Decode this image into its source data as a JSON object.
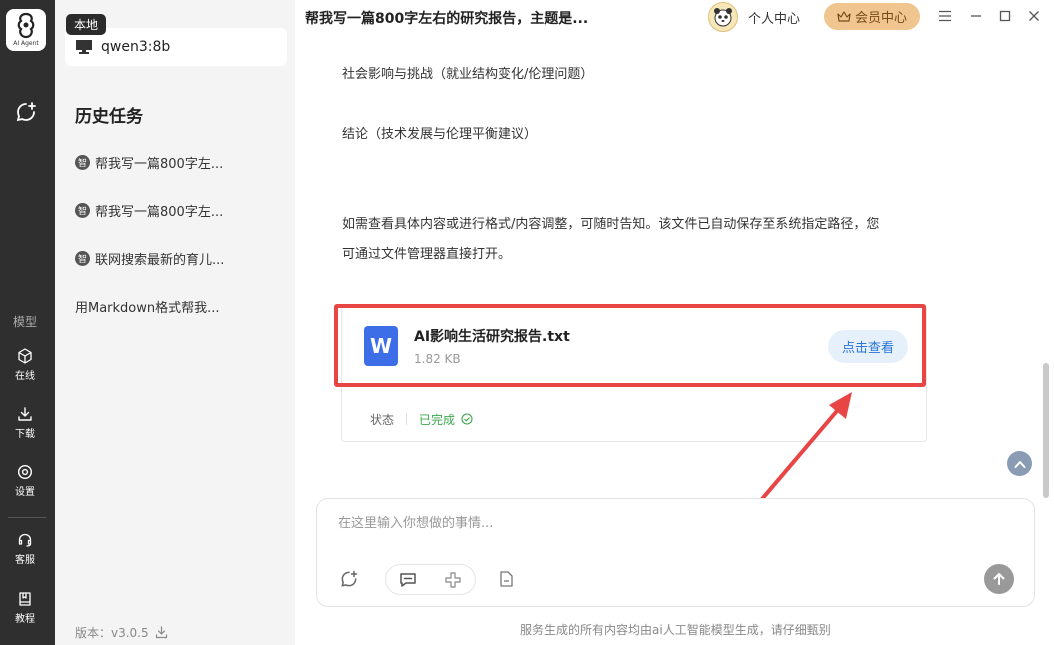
{
  "rail": {
    "logo_text": "AI Agent",
    "section_label": "模型",
    "items": [
      {
        "label": "在线"
      },
      {
        "label": "下载"
      },
      {
        "label": "设置"
      },
      {
        "label": "客服"
      },
      {
        "label": "教程"
      }
    ]
  },
  "sidebar": {
    "badge": "本地",
    "model_name": "qwen3:8b",
    "history_title": "历史任务",
    "history": [
      {
        "icon": "智",
        "label": "帮我写一篇800字左..."
      },
      {
        "icon": "智",
        "label": "帮我写一篇800字左..."
      },
      {
        "icon": "智",
        "label": "联网搜索最新的育儿..."
      },
      {
        "icon": "",
        "label": "用Markdown格式帮我..."
      }
    ],
    "version": "版本：v3.0.5"
  },
  "titlebar": {
    "title": "帮我写一篇800字左右的研究报告，主题是...",
    "personal_center": "个人中心",
    "vip_center": "会员中心"
  },
  "content": {
    "lines": [
      "社会影响与挑战（就业结构变化/伦理问题）",
      "结论（技术发展与伦理平衡建议）",
      "如需查看具体内容或进行格式/内容调整，可随时告知。该文件已自动保存至系统指定路径，您",
      "可通过文件管理器直接打开。"
    ],
    "file": {
      "icon_letter": "W",
      "name": "AI影响生活研究报告.txt",
      "size": "1.82 KB",
      "view_label": "点击查看",
      "status_label": "状态",
      "status_value": "已完成"
    }
  },
  "input": {
    "placeholder": "在这里输入你想做的事情...",
    "disclaimer": "服务生成的所有内容均由ai人工智能模型生成，请仔细甄别"
  },
  "colors": {
    "accent_red": "#e84545",
    "status_green": "#3aa84c",
    "link_blue": "#2a74d6",
    "vip_gold": "#f0c58f"
  }
}
